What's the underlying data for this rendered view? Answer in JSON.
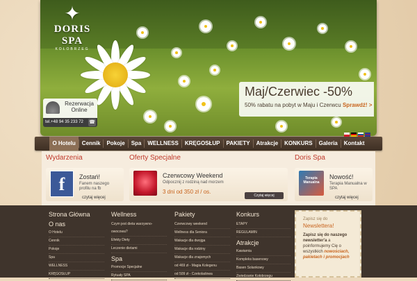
{
  "brand": {
    "name": "DORIS SPA",
    "tagline": "KOŁOBRZEG"
  },
  "hero": {
    "promo_title": "Maj/Czerwiec -50%",
    "promo_text": "50% rabatu na pobyt w Maju i Czerwcu",
    "promo_cta": "Sprawdź! >"
  },
  "reservation": {
    "label_line1": "Rezerwacja",
    "label_line2": "Online",
    "phone": "tel.+48 94 35 233 72"
  },
  "nav": [
    "O Hotelu",
    "Cennik",
    "Pokoje",
    "Spa",
    "WELLNESS",
    "KRĘGOSŁUP",
    "PAKIETY",
    "Atrakcje",
    "KONKURS",
    "Galeria",
    "Kontakt"
  ],
  "columns": {
    "events": {
      "title": "Wydarzenia",
      "card_title": "Zostań!",
      "card_text": "Fanem naszego profilu na fb",
      "more": "czytaj więcej"
    },
    "offers": {
      "title": "Oferty Specjalne",
      "card_title": "Czerwcowy Weekend",
      "card_text": "Odpocznij z rodziną nad morzem",
      "price": "3 dni od 350 zł / os.",
      "more": "Czytaj więcej"
    },
    "spa": {
      "title": "Doris Spa",
      "card_title": "Nowość!",
      "card_text": "Terapia Manualna w SPA",
      "img_text": "Terapia Manualna",
      "more": "czytaj więcej"
    }
  },
  "footer": {
    "col1": {
      "title": "Strona Główna",
      "sub": "O nas",
      "links": [
        "O Hotelu",
        "Cennik",
        "Pokoje",
        "Spa",
        "WELLNESS",
        "KRĘGOSŁUP"
      ]
    },
    "col2": {
      "title": "Wellness",
      "links": [
        "Czym jest dieta warzywno-owocowa?",
        "Efekty Diety",
        "Leczenie dietami"
      ],
      "sub": "Spa",
      "links2": [
        "Promocje Specjalne",
        "Rytuały SPA"
      ]
    },
    "col3": {
      "title": "Pakiety",
      "links": [
        "Czerwcowy weekend",
        "Wellness dla Seniora",
        "Wakacje dla dwojga",
        "Wakacje dla rodziny",
        "Wakacje dla znajomych",
        "od 469 zł - Magia Kolegenu",
        "od 509 zł - Czekoladowa"
      ]
    },
    "col4": {
      "title": "Konkurs",
      "links": [
        "ETAPY",
        "REGULAMIN"
      ],
      "sub": "Atrakcje",
      "links2": [
        "Kawiarnia",
        "Kompleks basenowy",
        "Basen Solankowy",
        "Zwiedzanie Kołobrzegu"
      ]
    },
    "newsletter": {
      "intro": "Zapisz się do",
      "title": "Newslettera!",
      "text_bold": "Zapisz się do naszego newsletter'a",
      "text": " a poinformujemy Cię o wszystkich ",
      "highlight": "nowościach, pakietach i promocjach"
    }
  },
  "colors": {
    "accent": "#c8641e",
    "heading_red": "#c0392b",
    "nav_bg": "#4a3a2e",
    "footer_bg": "#3f342c"
  }
}
